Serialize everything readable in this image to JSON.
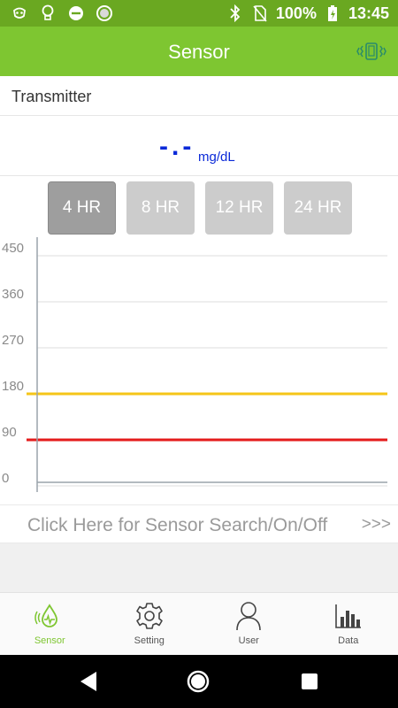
{
  "status_bar": {
    "battery": "100%",
    "time": "13:45",
    "icons": [
      "android-face-icon",
      "lightbulb-icon",
      "do-not-disturb-icon",
      "record-icon",
      "bluetooth-icon",
      "no-sim-icon",
      "battery-charging-icon"
    ],
    "color": "#6aa821"
  },
  "app_bar": {
    "title": "Sensor",
    "action_icon": "vibrate-icon",
    "color": "#7ec631"
  },
  "transmitter": {
    "label": "Transmitter"
  },
  "reading": {
    "value": "-.-",
    "unit": "mg/dL",
    "color": "#0a29d8"
  },
  "range_buttons": [
    {
      "label": "4 HR",
      "active": true
    },
    {
      "label": "8 HR",
      "active": false
    },
    {
      "label": "12 HR",
      "active": false
    },
    {
      "label": "24 HR",
      "active": false
    }
  ],
  "chart_data": {
    "type": "line",
    "y_ticks": [
      "450",
      "360",
      "270",
      "180",
      "90",
      "0"
    ],
    "ylim": [
      0,
      450
    ],
    "grid": true,
    "series": [],
    "thresholds": [
      {
        "value": 180,
        "color": "#f5c518"
      },
      {
        "value": 90,
        "color": "#e41b1b"
      }
    ]
  },
  "sensor_search": {
    "label": "Click Here for Sensor Search/On/Off",
    "arrows": ">>>"
  },
  "bottom_nav": [
    {
      "label": "Sensor",
      "icon": "sensor-drop-icon",
      "active": true
    },
    {
      "label": "Setting",
      "icon": "gear-icon",
      "active": false
    },
    {
      "label": "User",
      "icon": "user-icon",
      "active": false
    },
    {
      "label": "Data",
      "icon": "bar-chart-icon",
      "active": false
    }
  ],
  "system_nav": {
    "icons": [
      "back-icon",
      "home-icon",
      "recents-icon"
    ]
  }
}
